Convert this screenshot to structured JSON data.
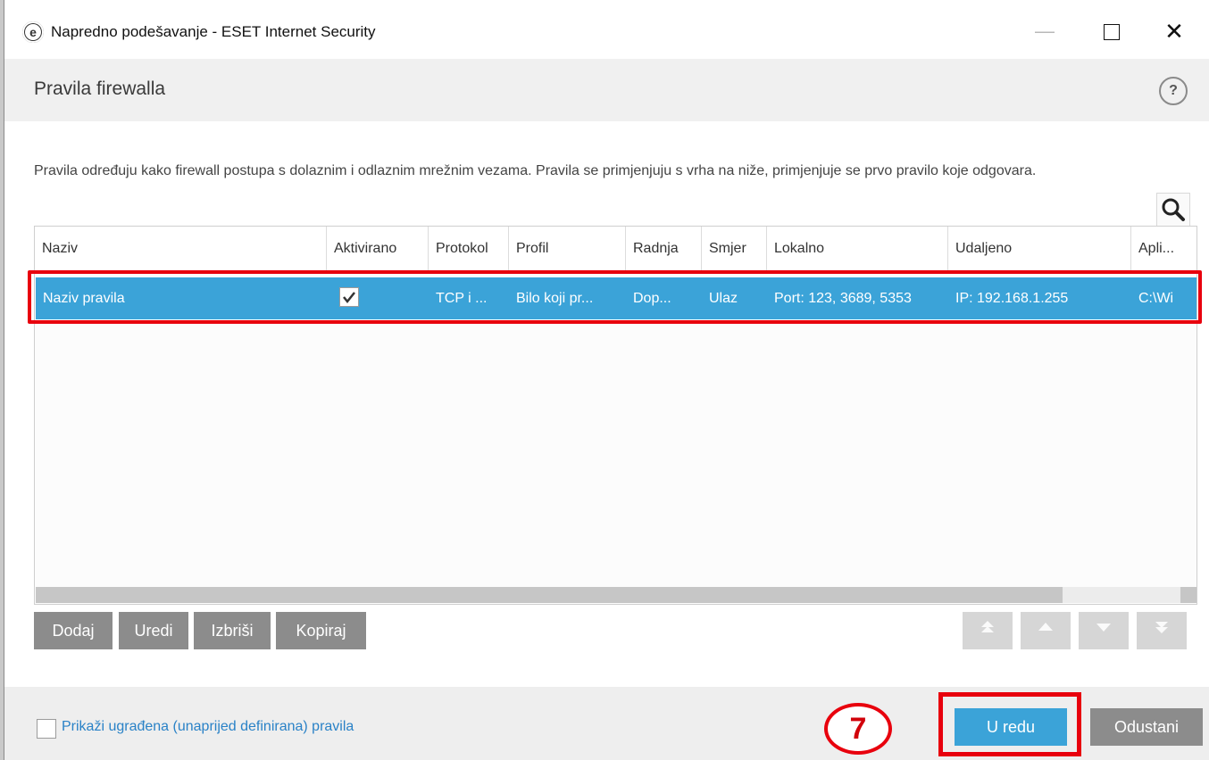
{
  "window": {
    "title": "Napredno podešavanje - ESET Internet Security",
    "logo_letter": "e"
  },
  "header": {
    "title": "Pravila firewalla",
    "help_symbol": "?"
  },
  "description": "Pravila određuju kako firewall postupa s dolaznim i odlaznim mrežnim vezama. Pravila se primjenjuju s vrha na niže, primjenjuje se prvo pravilo koje odgovara.",
  "table": {
    "columns": [
      "Naziv",
      "Aktivirano",
      "Protokol",
      "Profil",
      "Radnja",
      "Smjer",
      "Lokalno",
      "Udaljeno",
      "Apli..."
    ],
    "rows": [
      {
        "name": "Naziv pravila",
        "enabled": true,
        "protocol": "TCP i ...",
        "profile": "Bilo koji pr...",
        "action": "Dop...",
        "direction": "Ulaz",
        "local": "Port: 123, 3689, 5353",
        "remote": "IP: 192.168.1.255",
        "app": "C:\\Wi"
      }
    ]
  },
  "actions": {
    "add": "Dodaj",
    "edit": "Uredi",
    "delete": "Izbriši",
    "copy": "Kopiraj"
  },
  "footer": {
    "show_builtin_label": "Prikaži ugrađena (unaprijed definirana) pravila",
    "step_number": "7",
    "ok_label": "U redu",
    "cancel_label": "Odustani"
  },
  "colors": {
    "selection": "#3ba3d8",
    "highlight": "#e8000d",
    "button_gray": "#8c8c8c",
    "link": "#2a82c7"
  },
  "icons": [
    "search-icon",
    "checkmark-icon",
    "move-top-icon",
    "move-up-icon",
    "move-down-icon",
    "move-bottom-icon",
    "help-icon"
  ]
}
